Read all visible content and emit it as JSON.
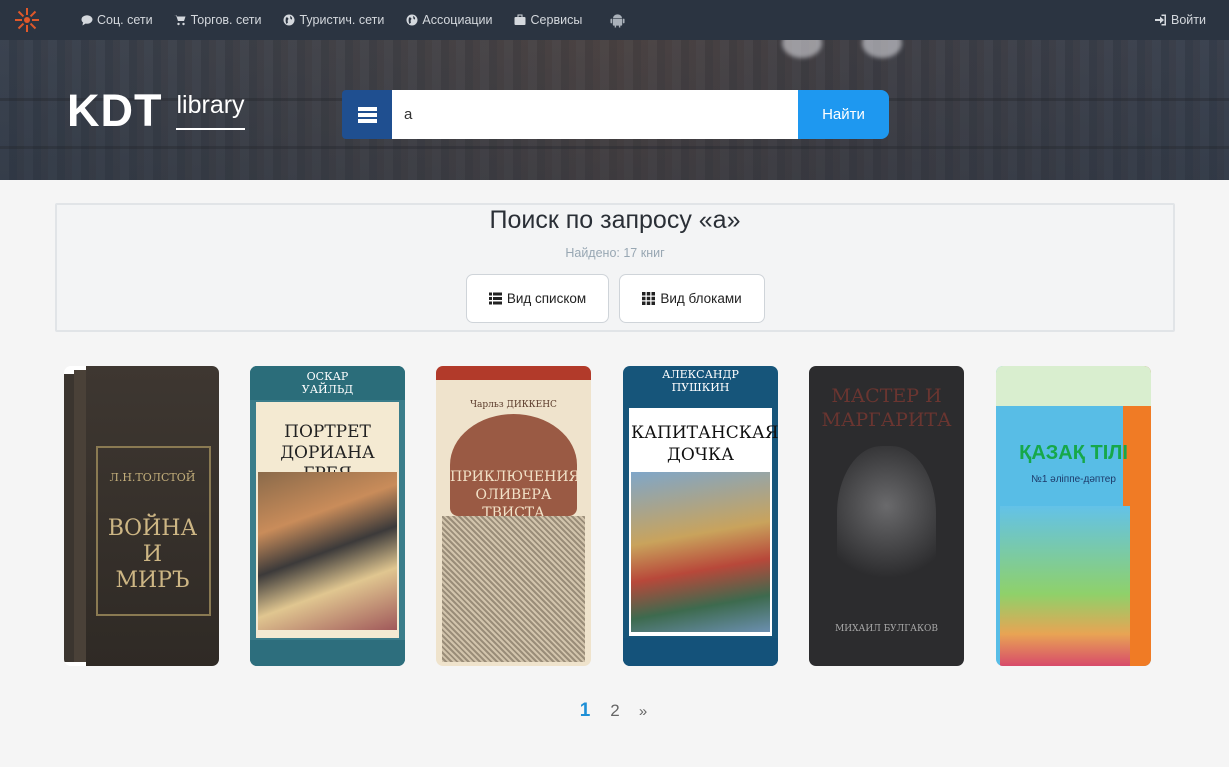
{
  "nav": {
    "links": [
      {
        "label": "Соц. сети",
        "icon": "comment-icon"
      },
      {
        "label": "Торгов. сети",
        "icon": "cart-icon"
      },
      {
        "label": "Туристич. сети",
        "icon": "globe-icon"
      },
      {
        "label": "Ассоциации",
        "icon": "globe-icon"
      },
      {
        "label": "Сервисы",
        "icon": "briefcase-icon"
      }
    ],
    "android_icon": "android-icon",
    "login_label": "Войти"
  },
  "brand": {
    "name": "KDT",
    "sub": "library"
  },
  "search": {
    "value": "а",
    "button_label": "Найти"
  },
  "results": {
    "title": "Поиск по запросу «а»",
    "found": "Найдено: 17 книг",
    "view_list_label": "Вид списком",
    "view_grid_label": "Вид блоками"
  },
  "books": [
    {
      "cover": "Л.Н.ТОЛСТОЙ ВОЙНА И МИРЪ",
      "author": "Л.Н.ТОЛСТОЙ",
      "title": "ВОЙНА И МИРЪ"
    },
    {
      "cover": "ОСКАР УАЙЛЬД ПОРТРЕТ ДОРИАНА ГРЕЯ",
      "author": "ОСКАР УАЙЛЬД",
      "title": "ПОРТРЕТ ДОРИАНА ГРЕЯ"
    },
    {
      "cover": "Чарльз Диккенс ПРИКЛЮЧЕНИЯ ОЛИВЕРА ТВИСТА",
      "author": "Чарльз ДИККЕНС",
      "title": "ПРИКЛЮЧЕНИЯ ОЛИВЕРА ТВИСТА"
    },
    {
      "cover": "АЛЕКСАНДР ПУШКИН КАПИТАНСКАЯ ДОЧКА",
      "author": "АЛЕКСАНДР ПУШКИН",
      "title": "КАПИТАНСКАЯ ДОЧКА"
    },
    {
      "cover": "МАСТЕР И МАРГАРИТА МИХАИЛ БУЛГАКОВ",
      "author": "МИХАИЛ БУЛГАКОВ",
      "title": "МАСТЕР И МАРГАРИТА"
    },
    {
      "cover": "ҚАЗАҚ ТІЛІ №1 әліппе-дәптер",
      "author": "",
      "title": "ҚАЗАҚ ТІЛІ"
    }
  ],
  "pagination": {
    "current": "1",
    "next_page": "2",
    "next_label": "»"
  }
}
